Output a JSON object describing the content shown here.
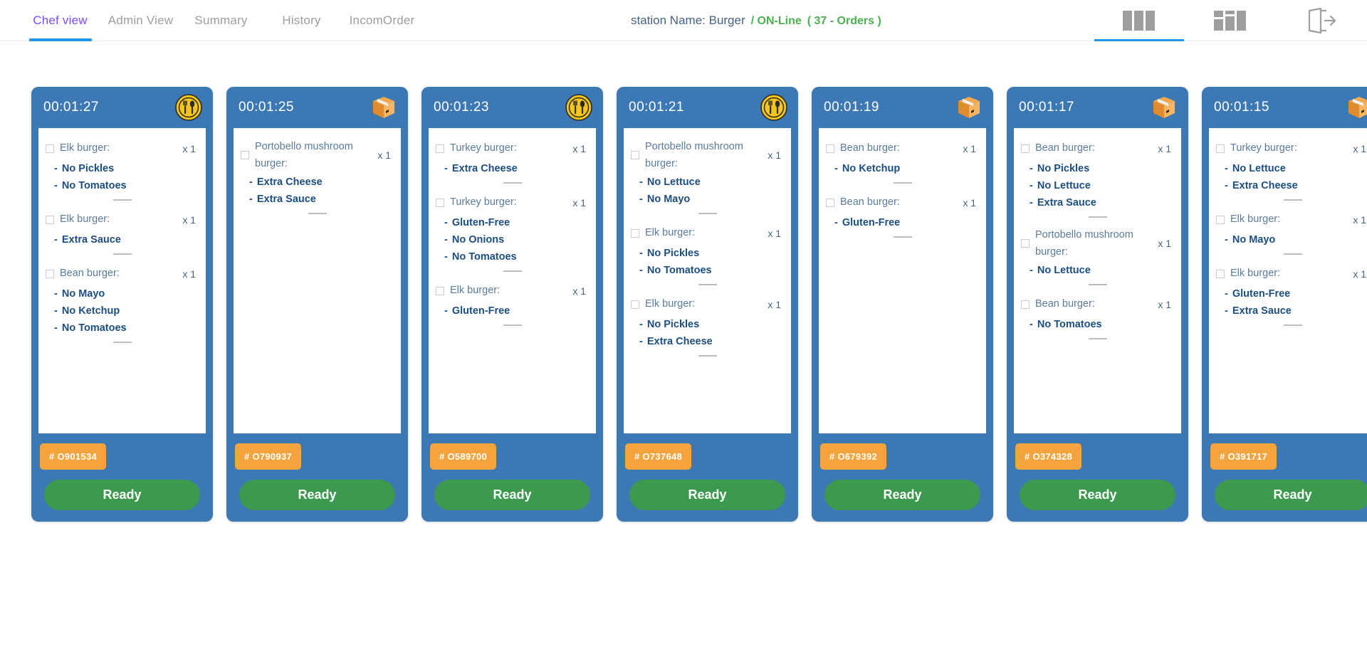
{
  "header": {
    "tabs": [
      {
        "label": "Chef view",
        "active": true
      },
      {
        "label": "Admin View",
        "active": false
      },
      {
        "label": "Summary",
        "active": false
      },
      {
        "label": "History",
        "active": false
      },
      {
        "label": "IncomOrder",
        "active": false
      }
    ],
    "station_name": "station Name: Burger",
    "station_status": "/ ON-Line",
    "station_orders": "( 37 - Orders )",
    "icons": [
      {
        "name": "three-column-layout-icon",
        "active": true
      },
      {
        "name": "grid-layout-icon",
        "active": false
      },
      {
        "name": "logout-icon",
        "active": false
      }
    ],
    "colors": {
      "active_tab": "#7c4dff",
      "tab_underline": "#2196f3",
      "inactive_tab": "#9e9e9e",
      "status_green": "#4caf50",
      "station_text": "#46637f"
    }
  },
  "board": {
    "colors": {
      "card_background": "#3b78b4",
      "body_background": "#ffffff",
      "item_name": "#5a7b99",
      "modifier": "#1c4e80",
      "order_badge": "#f5a33c",
      "ready_button": "#3c9a4e"
    },
    "ready_label": "Ready",
    "cards": [
      {
        "timer": "00:01:27",
        "type": "dine-in",
        "order_no": "# O901534",
        "items": [
          {
            "name": "Elk burger:",
            "qty": "x 1",
            "mods": [
              "No Pickles",
              "No Tomatoes"
            ]
          },
          {
            "name": "Elk burger:",
            "qty": "x 1",
            "mods": [
              "Extra Sauce"
            ]
          },
          {
            "name": "Bean burger:",
            "qty": "x 1",
            "mods": [
              "No Mayo",
              "No Ketchup",
              "No Tomatoes"
            ]
          }
        ]
      },
      {
        "timer": "00:01:25",
        "type": "takeaway",
        "order_no": "# O790937",
        "items": [
          {
            "name": "Portobello mushroom burger:",
            "qty": "x 1",
            "mods": [
              "Extra Cheese",
              "Extra Sauce"
            ]
          }
        ]
      },
      {
        "timer": "00:01:23",
        "type": "dine-in",
        "order_no": "# O589700",
        "items": [
          {
            "name": "Turkey burger:",
            "qty": "x 1",
            "mods": [
              "Extra Cheese"
            ]
          },
          {
            "name": "Turkey burger:",
            "qty": "x 1",
            "mods": [
              "Gluten-Free",
              "No Onions",
              "No Tomatoes"
            ]
          },
          {
            "name": "Elk burger:",
            "qty": "x 1",
            "mods": [
              "Gluten-Free"
            ]
          }
        ]
      },
      {
        "timer": "00:01:21",
        "type": "dine-in",
        "order_no": "# O737648",
        "items": [
          {
            "name": "Portobello mushroom burger:",
            "qty": "x 1",
            "mods": [
              "No Lettuce",
              "No Mayo"
            ]
          },
          {
            "name": "Elk burger:",
            "qty": "x 1",
            "mods": [
              "No Pickles",
              "No Tomatoes"
            ]
          },
          {
            "name": "Elk burger:",
            "qty": "x 1",
            "mods": [
              "No Pickles",
              "Extra Cheese"
            ]
          }
        ]
      },
      {
        "timer": "00:01:19",
        "type": "takeaway",
        "order_no": "# O679392",
        "items": [
          {
            "name": "Bean burger:",
            "qty": "x 1",
            "mods": [
              "No Ketchup"
            ]
          },
          {
            "name": "Bean burger:",
            "qty": "x 1",
            "mods": [
              "Gluten-Free"
            ]
          }
        ]
      },
      {
        "timer": "00:01:17",
        "type": "takeaway",
        "order_no": "# O374328",
        "items": [
          {
            "name": "Bean burger:",
            "qty": "x 1",
            "mods": [
              "No Pickles",
              "No Lettuce",
              "Extra Sauce"
            ]
          },
          {
            "name": "Portobello mushroom burger:",
            "qty": "x 1",
            "mods": [
              "No Lettuce"
            ]
          },
          {
            "name": "Bean burger:",
            "qty": "x 1",
            "mods": [
              "No Tomatoes"
            ]
          }
        ]
      },
      {
        "timer": "00:01:15",
        "type": "takeaway",
        "order_no": "# O391717",
        "items": [
          {
            "name": "Turkey burger:",
            "qty": "x 1",
            "mods": [
              "No Lettuce",
              "Extra Cheese"
            ]
          },
          {
            "name": "Elk burger:",
            "qty": "x 1",
            "mods": [
              "No Mayo"
            ]
          },
          {
            "name": "Elk burger:",
            "qty": "x 1",
            "mods": [
              "Gluten-Free",
              "Extra Sauce"
            ]
          }
        ]
      }
    ]
  }
}
